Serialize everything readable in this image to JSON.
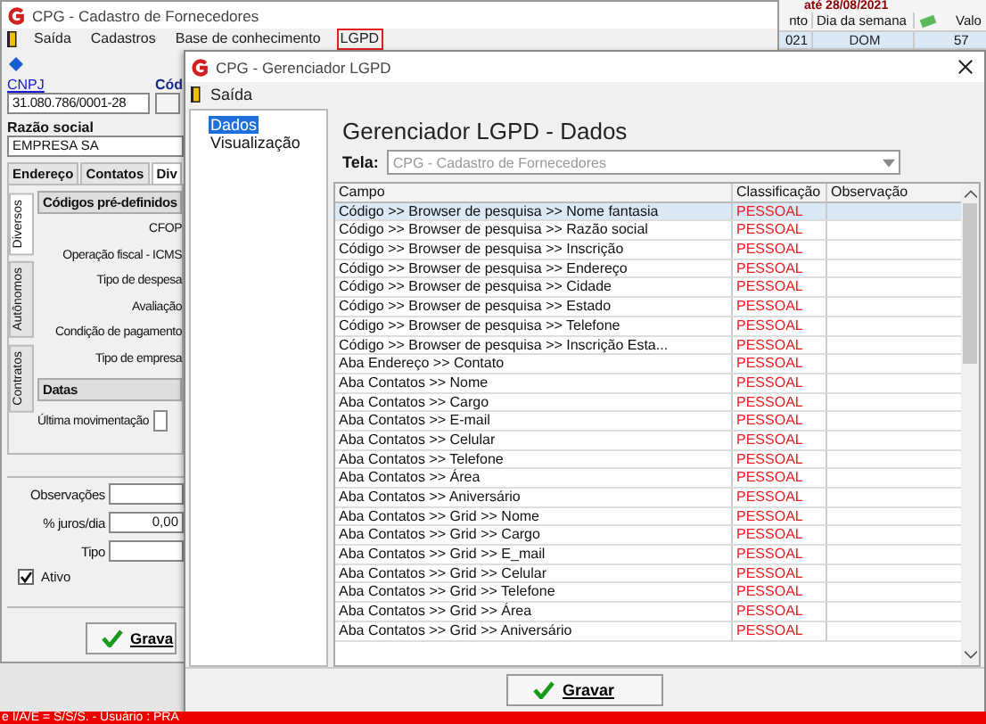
{
  "background_panel": {
    "heading": "até 28/08/2021",
    "columns": [
      "nto",
      "Dia da semana",
      "Valo"
    ],
    "row": [
      "021",
      "DOM",
      "57"
    ]
  },
  "main_window": {
    "title": "CPG - Cadastro de Fornecedores",
    "menu": [
      {
        "label": "Saída",
        "kind": "exit",
        "selected": false
      },
      {
        "label": "Cadastros",
        "kind": "plain",
        "selected": false
      },
      {
        "label": "Base de conhecimento",
        "kind": "plain",
        "selected": false
      },
      {
        "label": "LGPD",
        "kind": "plain",
        "selected": true
      }
    ],
    "cnpj": {
      "label": "CNPJ",
      "value": "31.080.786/0001-28"
    },
    "code_label": "Cód",
    "razao_social": {
      "label": "Razão social",
      "value": "EMPRESA SA"
    },
    "tabs": [
      {
        "label": "Endereço",
        "selected": false
      },
      {
        "label": "Contatos",
        "selected": false
      },
      {
        "label": "Div",
        "selected": true
      }
    ],
    "side_tabs": [
      {
        "label": "Diversos",
        "selected": true
      },
      {
        "label": "Autônomos",
        "selected": false
      },
      {
        "label": "Contratos",
        "selected": false
      }
    ],
    "section_codes": {
      "title": "Códigos pré-definidos",
      "fields": [
        "CFOP",
        "Operação fiscal - ICMS",
        "Tipo de despesa",
        "Avaliação",
        "Condição de pagamento",
        "Tipo de empresa"
      ]
    },
    "section_dates": {
      "title": "Datas",
      "fields": [
        "Última movimentação"
      ]
    },
    "fields": [
      {
        "label": "Observações"
      },
      {
        "label": "% juros/dia",
        "value": "0,00"
      },
      {
        "label": "Tipo"
      }
    ],
    "active": {
      "label": "Ativo",
      "checked": true
    },
    "save_button": "Grava"
  },
  "lgpd_window": {
    "title": "CPG - Gerenciador LGPD",
    "menu": "Saída",
    "nav": [
      {
        "label": "Dados",
        "selected": true
      },
      {
        "label": "Visualização",
        "selected": false
      }
    ],
    "heading": "Gerenciador LGPD - Dados",
    "screen_label": "Tela:",
    "screen_value": "CPG - Cadastro de Fornecedores",
    "columns": [
      "Campo",
      "Classificação",
      "Observação"
    ],
    "rows": [
      {
        "campo": "Código >> Browser de pesquisa >> Nome fantasia",
        "classificacao": "PESSOAL",
        "selected": true
      },
      {
        "campo": "Código >> Browser de pesquisa >> Razão social",
        "classificacao": "PESSOAL",
        "selected": false
      },
      {
        "campo": "Código >> Browser de pesquisa >> Inscrição",
        "classificacao": "PESSOAL",
        "selected": false
      },
      {
        "campo": "Código >> Browser de pesquisa >> Endereço",
        "classificacao": "PESSOAL",
        "selected": false
      },
      {
        "campo": "Código >> Browser de pesquisa >> Cidade",
        "classificacao": "PESSOAL",
        "selected": false
      },
      {
        "campo": "Código >> Browser de pesquisa >> Estado",
        "classificacao": "PESSOAL",
        "selected": false
      },
      {
        "campo": "Código >> Browser de pesquisa >> Telefone",
        "classificacao": "PESSOAL",
        "selected": false
      },
      {
        "campo": "Código >> Browser de pesquisa >> Inscrição Esta...",
        "classificacao": "PESSOAL",
        "selected": false
      },
      {
        "campo": "Aba Endereço >> Contato",
        "classificacao": "PESSOAL",
        "selected": false
      },
      {
        "campo": "Aba Contatos >> Nome",
        "classificacao": "PESSOAL",
        "selected": false
      },
      {
        "campo": "Aba Contatos >> Cargo",
        "classificacao": "PESSOAL",
        "selected": false
      },
      {
        "campo": "Aba Contatos >> E-mail",
        "classificacao": "PESSOAL",
        "selected": false
      },
      {
        "campo": "Aba Contatos >> Celular",
        "classificacao": "PESSOAL",
        "selected": false
      },
      {
        "campo": "Aba Contatos >> Telefone",
        "classificacao": "PESSOAL",
        "selected": false
      },
      {
        "campo": "Aba Contatos >> Área",
        "classificacao": "PESSOAL",
        "selected": false
      },
      {
        "campo": "Aba Contatos >> Aniversário",
        "classificacao": "PESSOAL",
        "selected": false
      },
      {
        "campo": "Aba Contatos >> Grid >> Nome",
        "classificacao": "PESSOAL",
        "selected": false
      },
      {
        "campo": "Aba Contatos >> Grid >> Cargo",
        "classificacao": "PESSOAL",
        "selected": false
      },
      {
        "campo": "Aba Contatos >> Grid >> E_mail",
        "classificacao": "PESSOAL",
        "selected": false
      },
      {
        "campo": "Aba Contatos >> Grid >> Celular",
        "classificacao": "PESSOAL",
        "selected": false
      },
      {
        "campo": "Aba Contatos >> Grid >> Telefone",
        "classificacao": "PESSOAL",
        "selected": false
      },
      {
        "campo": "Aba Contatos >> Grid >> Área",
        "classificacao": "PESSOAL",
        "selected": false
      },
      {
        "campo": "Aba Contatos >> Grid >> Aniversário",
        "classificacao": "PESSOAL",
        "selected": false
      }
    ],
    "save_button": "Gravar"
  },
  "status_bar": "e I/A/E = S/S/S. - Usuário : PRA"
}
